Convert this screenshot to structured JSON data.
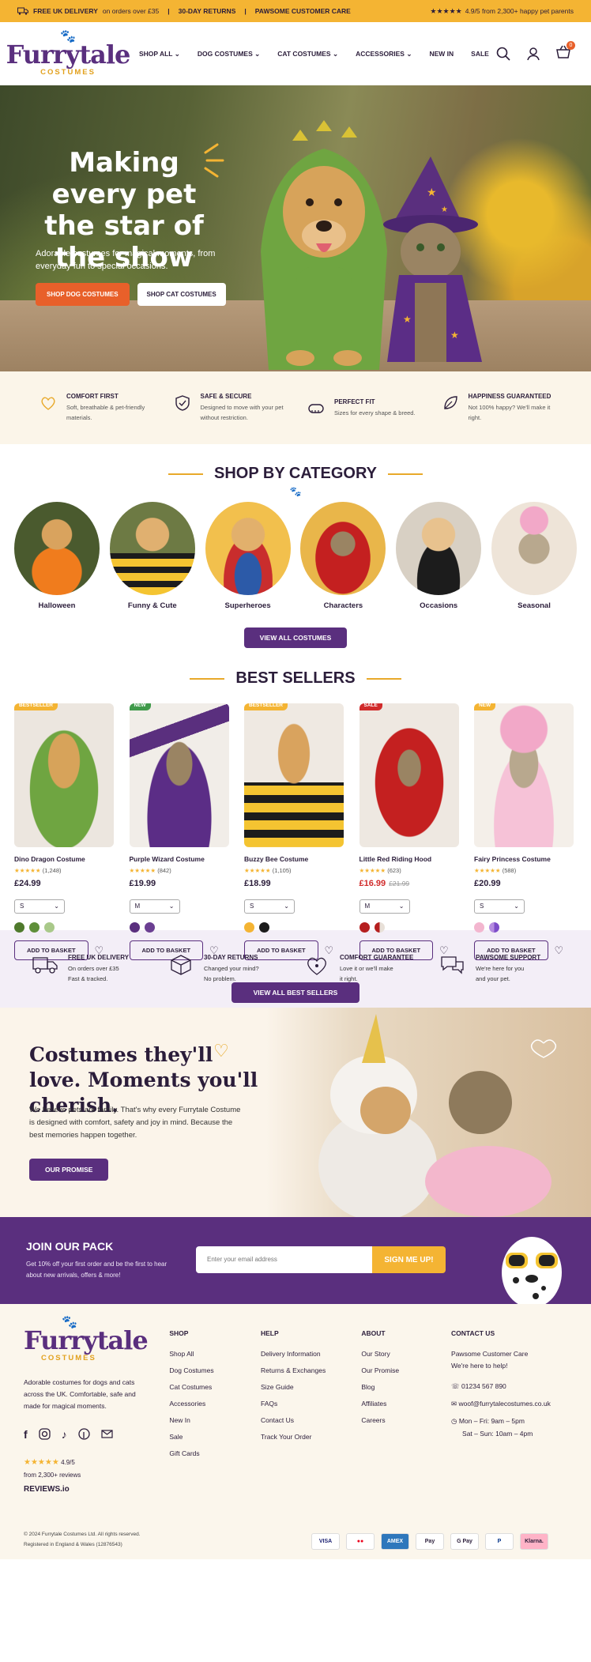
{
  "topbar": {
    "free_delivery_bold": "FREE UK DELIVERY",
    "free_delivery_rest": "on orders over £35",
    "returns": "30-DAY RETURNS",
    "care": "PAWSOME CUSTOMER CARE",
    "stars": "★★★★★",
    "rating": "4.9/5 from 2,300+ happy pet parents"
  },
  "brand": {
    "name": "Furrytale",
    "sub": "COSTUMES"
  },
  "nav": [
    "SHOP ALL ⌄",
    "DOG COSTUMES ⌄",
    "CAT COSTUMES ⌄",
    "ACCESSORIES ⌄",
    "NEW IN",
    "SALE"
  ],
  "cart_count": "0",
  "hero": {
    "headline": "Making every pet the star of the show",
    "desc": "Adorable costumes for magical moments, from everyday fun to special occasions.",
    "btn_dog": "SHOP DOG COSTUMES",
    "btn_cat": "SHOP CAT COSTUMES"
  },
  "features": [
    {
      "title": "COMFORT FIRST",
      "desc": "Soft, breathable & pet-friendly materials."
    },
    {
      "title": "SAFE & SECURE",
      "desc": "Designed to move with your pet without restriction."
    },
    {
      "title": "PERFECT FIT",
      "desc": "Sizes for every shape & breed."
    },
    {
      "title": "HAPPINESS GUARANTEED",
      "desc": "Not 100% happy? We'll make it right."
    }
  ],
  "categories": {
    "title": "SHOP BY CATEGORY",
    "items": [
      "Halloween",
      "Funny & Cute",
      "Superheroes",
      "Characters",
      "Occasions",
      "Seasonal"
    ],
    "button": "VIEW ALL COSTUMES"
  },
  "bestsellers": {
    "title": "BEST SELLERS",
    "button": "VIEW ALL BEST SELLERS",
    "add_label": "ADD TO BASKET",
    "products": [
      {
        "tag": "BESTSELLER",
        "name": "Dino Dragon Costume",
        "reviews": "(1,248)",
        "price": "£24.99",
        "was": "",
        "size": "S",
        "swatches": [
          "#4f7a2c",
          "#5f8f3a",
          "#a9c98a"
        ]
      },
      {
        "tag": "NEW",
        "name": "Purple Wizard Costume",
        "reviews": "(842)",
        "price": "£19.99",
        "was": "",
        "size": "M",
        "swatches": [
          "#5a2f7e",
          "#6b3f92"
        ]
      },
      {
        "tag": "BESTSELLER",
        "name": "Buzzy Bee Costume",
        "reviews": "(1,105)",
        "price": "£18.99",
        "was": "",
        "size": "S",
        "swatches": [
          "#f4b433",
          "#1c1c1c"
        ]
      },
      {
        "tag": "SALE",
        "name": "Little Red Riding Hood",
        "reviews": "(623)",
        "price": "£16.99",
        "was": "£21.99",
        "size": "M",
        "swatches": [
          "#b51f1f",
          "#e8e0d8"
        ]
      },
      {
        "tag": "NEW",
        "name": "Fairy Princess Costume",
        "reviews": "(588)",
        "price": "£20.99",
        "was": "",
        "size": "S",
        "swatches": [
          "#f3b6cf",
          "#b58ce0",
          "#7d4cc9"
        ]
      }
    ]
  },
  "perks": [
    {
      "title": "FREE UK DELIVERY",
      "desc1": "On orders over £35",
      "desc2": "Fast & tracked."
    },
    {
      "title": "30-DAY RETURNS",
      "desc1": "Changed your mind?",
      "desc2": "No problem."
    },
    {
      "title": "COMFORT GUARANTEE",
      "desc1": "Love it or we'll make",
      "desc2": "it right."
    },
    {
      "title": "PAWSOME SUPPORT",
      "desc1": "We're here for you",
      "desc2": "and your pet."
    }
  ],
  "promise": {
    "headline": "Costumes they'll love. Moments you'll cherish.",
    "body": "We believe pets are family. That's why every Furrytale Costume is designed with comfort, safety and joy in mind. Because the best memories happen together.",
    "button": "OUR PROMISE"
  },
  "newsletter": {
    "title": "JOIN OUR PACK",
    "desc": "Get 10% off your first order and be the first to hear about new arrivals, offers & more!",
    "placeholder": "Enter your email address",
    "button": "SIGN ME UP!"
  },
  "footer": {
    "blurb": "Adorable costumes for dogs and cats across the UK. Comfortable, safe and made for magical moments.",
    "rating": "4.9/5",
    "rating_sub": "from 2,300+ reviews",
    "reviews_brand": "REVIEWS.io",
    "shop": {
      "title": "SHOP",
      "items": [
        "Shop All",
        "Dog Costumes",
        "Cat Costumes",
        "Accessories",
        "New In",
        "Sale",
        "Gift Cards"
      ]
    },
    "help": {
      "title": "HELP",
      "items": [
        "Delivery Information",
        "Returns & Exchanges",
        "Size Guide",
        "FAQs",
        "Contact Us",
        "Track Your Order"
      ]
    },
    "about": {
      "title": "ABOUT",
      "items": [
        "Our Story",
        "Our Promise",
        "Blog",
        "Affiliates",
        "Careers"
      ]
    },
    "contact": {
      "title": "CONTACT US",
      "line1": "Pawsome Customer Care",
      "line2": "We're here to help!",
      "phone": "01234 567 890",
      "email": "woof@furrytalecostumes.co.uk",
      "hours1": "Mon – Fri: 9am – 5pm",
      "hours2": "Sat – Sun: 10am – 4pm"
    },
    "legal1": "© 2024 Furrytale Costumes Ltd. All rights reserved.",
    "legal2": "Registered in England & Wales (12876543)",
    "payments": [
      "VISA",
      "●●",
      "AMEX",
      "Pay",
      "G Pay",
      "P",
      "Klarna."
    ]
  }
}
